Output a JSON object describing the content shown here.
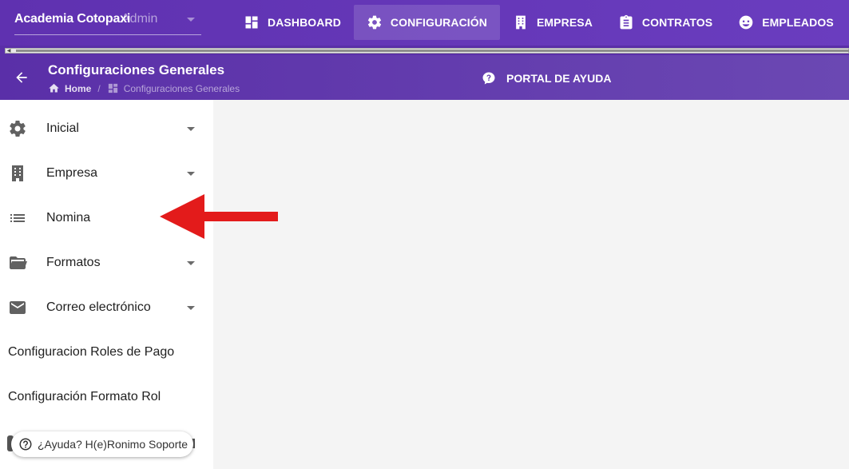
{
  "topbar": {
    "org_name": "Academia Cotopaxi",
    "org_role": "Admin",
    "nav": [
      {
        "label": "DASHBOARD",
        "icon": "dashboard-icon"
      },
      {
        "label": "CONFIGURACIÓN",
        "icon": "gear-icon",
        "active": true
      },
      {
        "label": "EMPRESA",
        "icon": "building-icon"
      },
      {
        "label": "CONTRATOS",
        "icon": "clipboard-icon"
      },
      {
        "label": "EMPLEADOS",
        "icon": "face-icon"
      }
    ]
  },
  "subheader": {
    "title": "Configuraciones Generales",
    "breadcrumb": {
      "home": "Home",
      "current": "Configuraciones Generales"
    },
    "help_portal": "PORTAL DE AYUDA"
  },
  "sidebar": {
    "items": [
      {
        "label": "Inicial",
        "icon": "gear-icon",
        "expandable": true
      },
      {
        "label": "Empresa",
        "icon": "building-icon",
        "expandable": true
      },
      {
        "label": "Nomina",
        "icon": "list-icon",
        "expandable": false
      },
      {
        "label": "Formatos",
        "icon": "folder-open-icon",
        "expandable": true
      },
      {
        "label": "Correo electrónico",
        "icon": "mail-icon",
        "expandable": true
      },
      {
        "label": "Configuracion Roles de Pago"
      },
      {
        "label": "Configuración Formato Rol"
      }
    ]
  },
  "help_chip": {
    "label": "¿Ayuda? H(e)Ronimo Soporte"
  },
  "colors": {
    "primary": "#5f31b0",
    "annotation_arrow": "#e31b1b",
    "content_bg": "#f4f4f4"
  }
}
